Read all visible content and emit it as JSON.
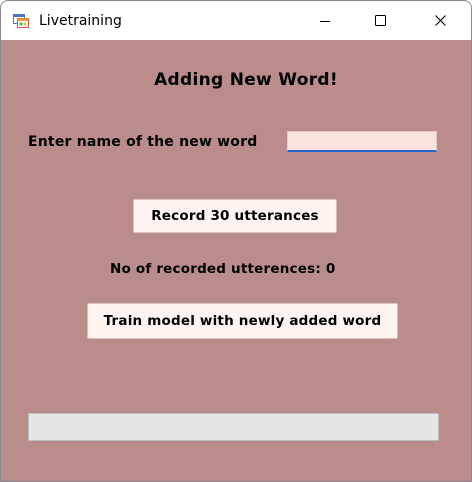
{
  "window": {
    "title": "Livetraining",
    "app_icon": "form-window-icon",
    "minimize_icon": "minimize-icon",
    "maximize_icon": "maximize-icon",
    "close_icon": "close-icon"
  },
  "form": {
    "heading": "Adding New Word!",
    "word_label": "Enter name of the new word",
    "word_input_value": "",
    "record_button_label": "Record 30 utterances",
    "count_label": "No of recorded utterences:",
    "count_value": "0",
    "train_button_label": "Train model with newly added word",
    "progress_fraction": 0
  },
  "colors": {
    "client_background": "#bb8c8c",
    "button_background": "#fff4f0",
    "input_background": "#fce3df",
    "input_focus_underline": "#2066c8",
    "progress_track": "#e5e5e5"
  }
}
